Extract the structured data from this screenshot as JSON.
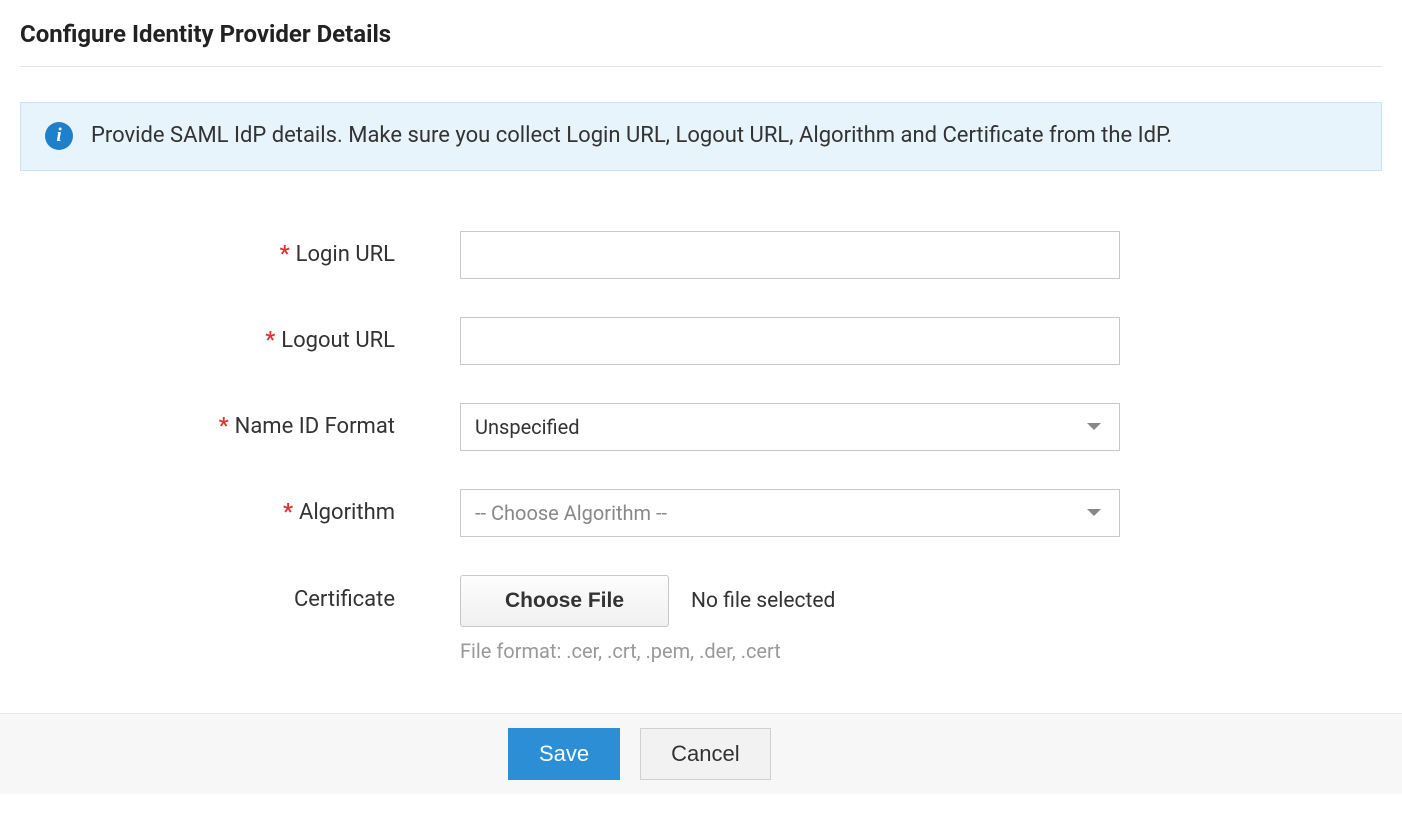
{
  "header": {
    "title": "Configure Identity Provider Details"
  },
  "banner": {
    "text": "Provide SAML IdP details. Make sure you collect Login URL, Logout URL, Algorithm and Certificate from the IdP."
  },
  "form": {
    "login_url": {
      "label": "Login URL",
      "required": true,
      "value": ""
    },
    "logout_url": {
      "label": "Logout URL",
      "required": true,
      "value": ""
    },
    "name_id_format": {
      "label": "Name ID Format",
      "required": true,
      "selected": "Unspecified"
    },
    "algorithm": {
      "label": "Algorithm",
      "required": true,
      "placeholder": "-- Choose Algorithm --"
    },
    "certificate": {
      "label": "Certificate",
      "required": false,
      "choose_file_label": "Choose File",
      "no_file_text": "No file selected",
      "hint": "File format: .cer, .crt, .pem, .der, .cert"
    }
  },
  "actions": {
    "save": "Save",
    "cancel": "Cancel"
  },
  "required_marker": "*"
}
